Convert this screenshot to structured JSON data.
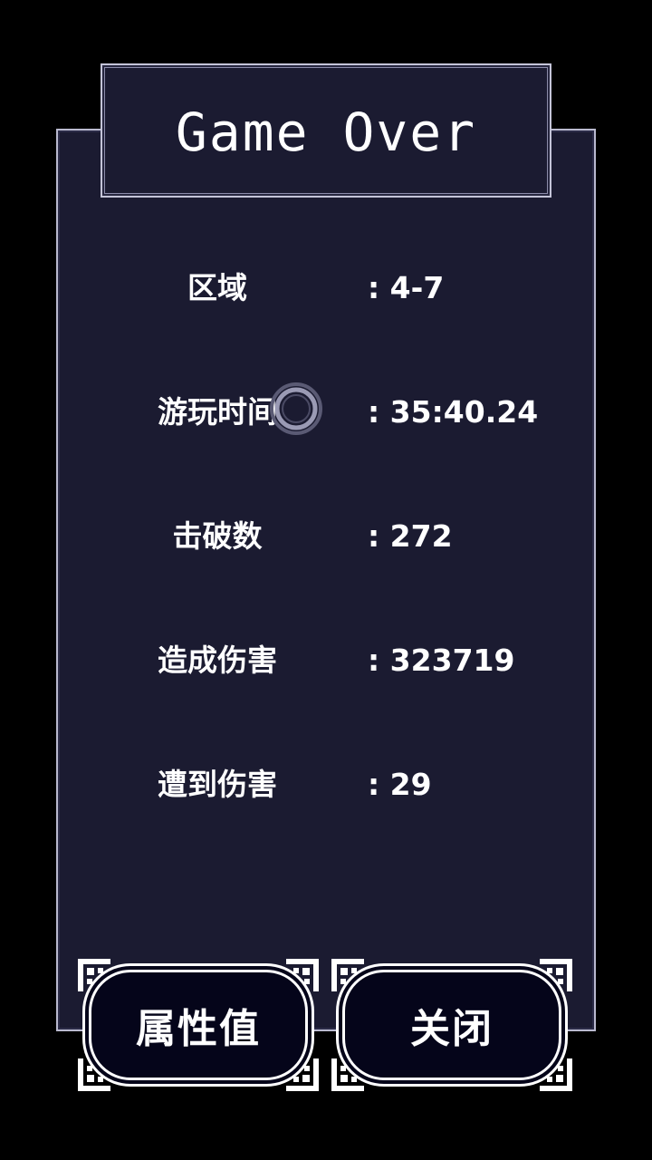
{
  "title": "Game Over",
  "stats": [
    {
      "label": "区域",
      "value": ": 4-7"
    },
    {
      "label": "游玩时间",
      "value": ": 35:40.24"
    },
    {
      "label": "击破数",
      "value": ": 272"
    },
    {
      "label": "造成伤害",
      "value": ": 323719"
    },
    {
      "label": "遭到伤害",
      "value": ": 29"
    }
  ],
  "buttons": {
    "attributes_label": "属性值",
    "close_label": "关闭"
  },
  "icons": {
    "loading": "loading-ring-icon"
  },
  "colors": {
    "background": "#000000",
    "panel": "#1b1b31",
    "panel_border": "#b9b9cf",
    "button_fill": "#05051a",
    "text": "#ffffff"
  }
}
